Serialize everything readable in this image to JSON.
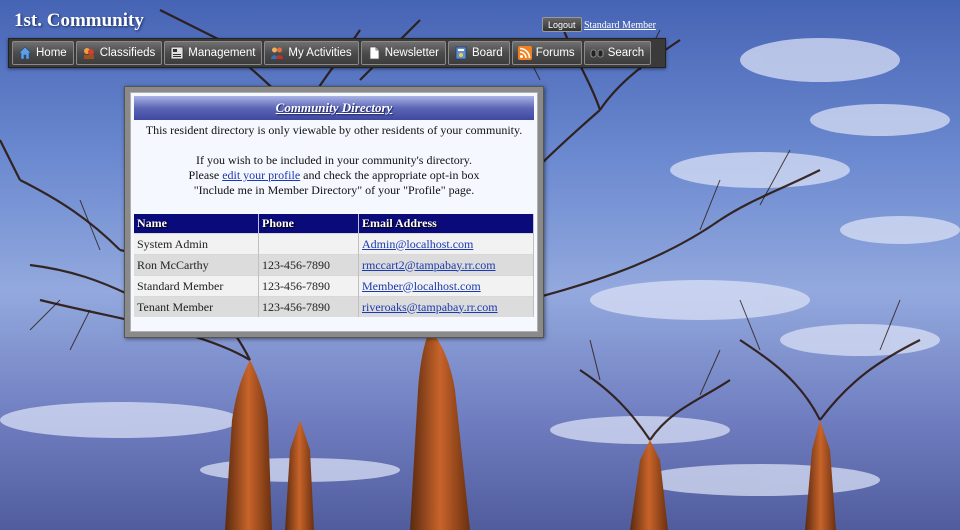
{
  "site": {
    "title": "1st. Community"
  },
  "header": {
    "logout_label": "Logout",
    "user_label": "Standard Member"
  },
  "nav": {
    "items": [
      {
        "label": "Home",
        "icon": "home-icon"
      },
      {
        "label": "Classifieds",
        "icon": "classifieds-icon"
      },
      {
        "label": "Management",
        "icon": "management-icon"
      },
      {
        "label": "My Activities",
        "icon": "activities-icon"
      },
      {
        "label": "Newsletter",
        "icon": "newsletter-icon"
      },
      {
        "label": "Board",
        "icon": "board-icon"
      },
      {
        "label": "Forums",
        "icon": "rss-icon"
      },
      {
        "label": "Search",
        "icon": "search-icon"
      }
    ]
  },
  "directory": {
    "title": "Community Directory",
    "intro_line1": "This resident directory is only viewable by other residents of your community.",
    "intro_line2": "If you wish to be included in your community's directory.",
    "intro_line3_before": "Please",
    "intro_link": "edit your profile",
    "intro_line3_after": " and check the appropriate opt-in box",
    "intro_line4": "\"Include me in Member Directory\" of your \"Profile\" page.",
    "columns": [
      "Name",
      "Phone",
      "Email Address"
    ],
    "rows": [
      {
        "name": "System Admin",
        "phone": "",
        "email": "Admin@localhost.com"
      },
      {
        "name": "Ron McCarthy",
        "phone": "123-456-7890",
        "email": "rmccart2@tampabay.rr.com"
      },
      {
        "name": "Standard Member",
        "phone": "123-456-7890",
        "email": "Member@localhost.com"
      },
      {
        "name": "Tenant Member",
        "phone": "123-456-7890",
        "email": "riveroaks@tampabay.rr.com"
      }
    ]
  },
  "colors": {
    "nav_background": "#3a3a3a",
    "table_header": "#0a0a7a",
    "link": "#1a3ab0",
    "panel_header": "#4a54a8"
  }
}
